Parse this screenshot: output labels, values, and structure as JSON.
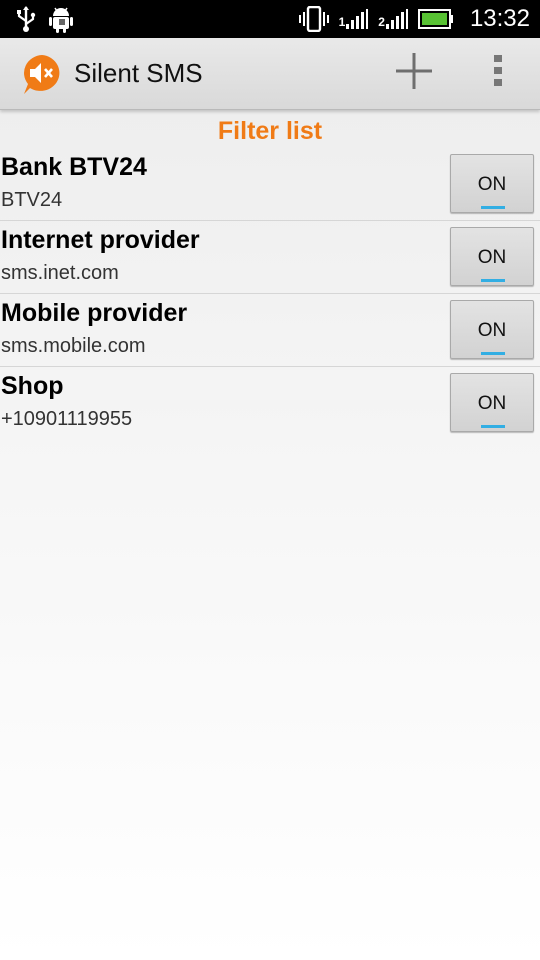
{
  "status_bar": {
    "time": "13:32",
    "sim1_label": "1",
    "sim2_label": "2",
    "icons": [
      "usb-icon",
      "android-debug-icon",
      "vibrate-icon",
      "signal-sim1-icon",
      "signal-sim2-icon",
      "battery-icon"
    ]
  },
  "action_bar": {
    "title": "Silent SMS",
    "icons": [
      "app-muted-speaker-icon",
      "add-icon",
      "overflow-menu-icon"
    ]
  },
  "list": {
    "header": "Filter list",
    "items": [
      {
        "name": "Bank BTV24",
        "address": "BTV24",
        "toggle": "ON"
      },
      {
        "name": "Internet provider",
        "address": "sms.inet.com",
        "toggle": "ON"
      },
      {
        "name": "Mobile provider",
        "address": "sms.mobile.com",
        "toggle": "ON"
      },
      {
        "name": "Shop",
        "address": "+10901119955",
        "toggle": "ON"
      }
    ]
  },
  "colors": {
    "accent_orange": "#f07b16",
    "toggle_indicator": "#32aee3",
    "battery_green": "#58c233"
  }
}
